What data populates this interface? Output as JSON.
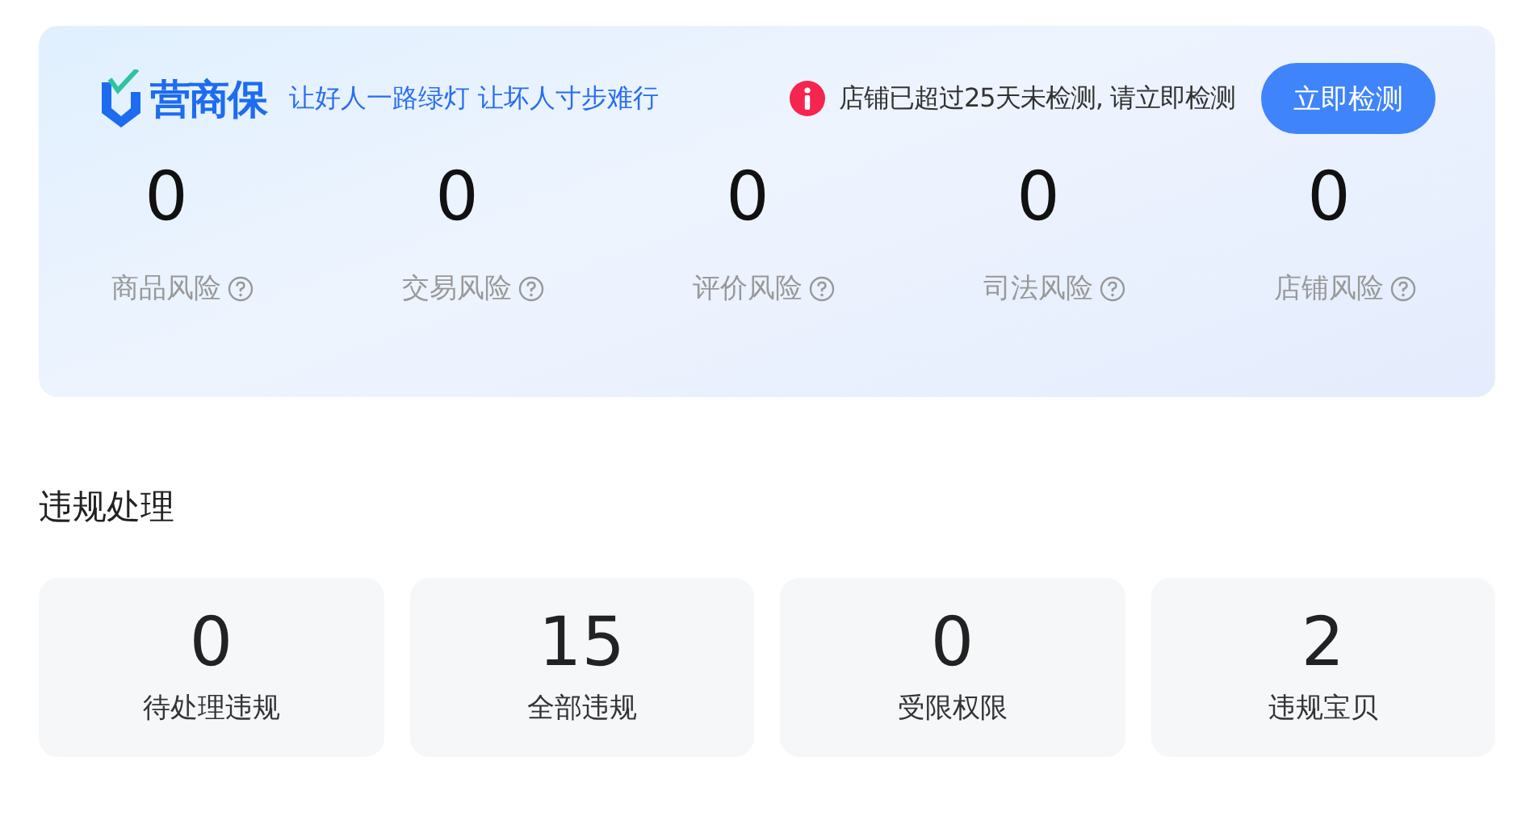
{
  "header": {
    "logo": "营商保",
    "slogan": "让好人一路绿灯 让坏人寸步难行",
    "alert": "店铺已超过25天未检测, 请立即检测",
    "button": "立即检测"
  },
  "risks": [
    {
      "value": "0",
      "label": "商品风险"
    },
    {
      "value": "0",
      "label": "交易风险"
    },
    {
      "value": "0",
      "label": "评价风险"
    },
    {
      "value": "0",
      "label": "司法风险"
    },
    {
      "value": "0",
      "label": "店铺风险"
    }
  ],
  "violations": {
    "title": "违规处理",
    "cards": [
      {
        "value": "0",
        "label": "待处理违规"
      },
      {
        "value": "15",
        "label": "全部违规"
      },
      {
        "value": "0",
        "label": "受限权限"
      },
      {
        "value": "2",
        "label": "违规宝贝"
      }
    ]
  }
}
